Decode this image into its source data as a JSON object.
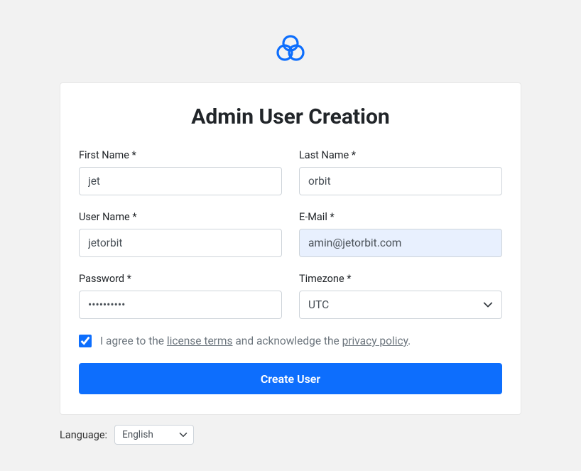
{
  "title": "Admin User Creation",
  "fields": {
    "first_name": {
      "label": "First Name *",
      "value": "jet"
    },
    "last_name": {
      "label": "Last Name *",
      "value": "orbit"
    },
    "user_name": {
      "label": "User Name *",
      "value": "jetorbit"
    },
    "email": {
      "label": "E-Mail *",
      "value": "amin@jetorbit.com"
    },
    "password": {
      "label": "Password *",
      "value": "••••••••••"
    },
    "timezone": {
      "label": "Timezone *",
      "value": "UTC"
    }
  },
  "agreement": {
    "checked": true,
    "prefix": "I agree to the ",
    "license_link": "license terms",
    "middle": " and acknowledge the ",
    "privacy_link": "privacy policy",
    "suffix": "."
  },
  "submit_label": "Create User",
  "language": {
    "label": "Language:",
    "value": "English"
  },
  "colors": {
    "primary": "#0d6efd",
    "autofill": "#e8f0fe"
  }
}
